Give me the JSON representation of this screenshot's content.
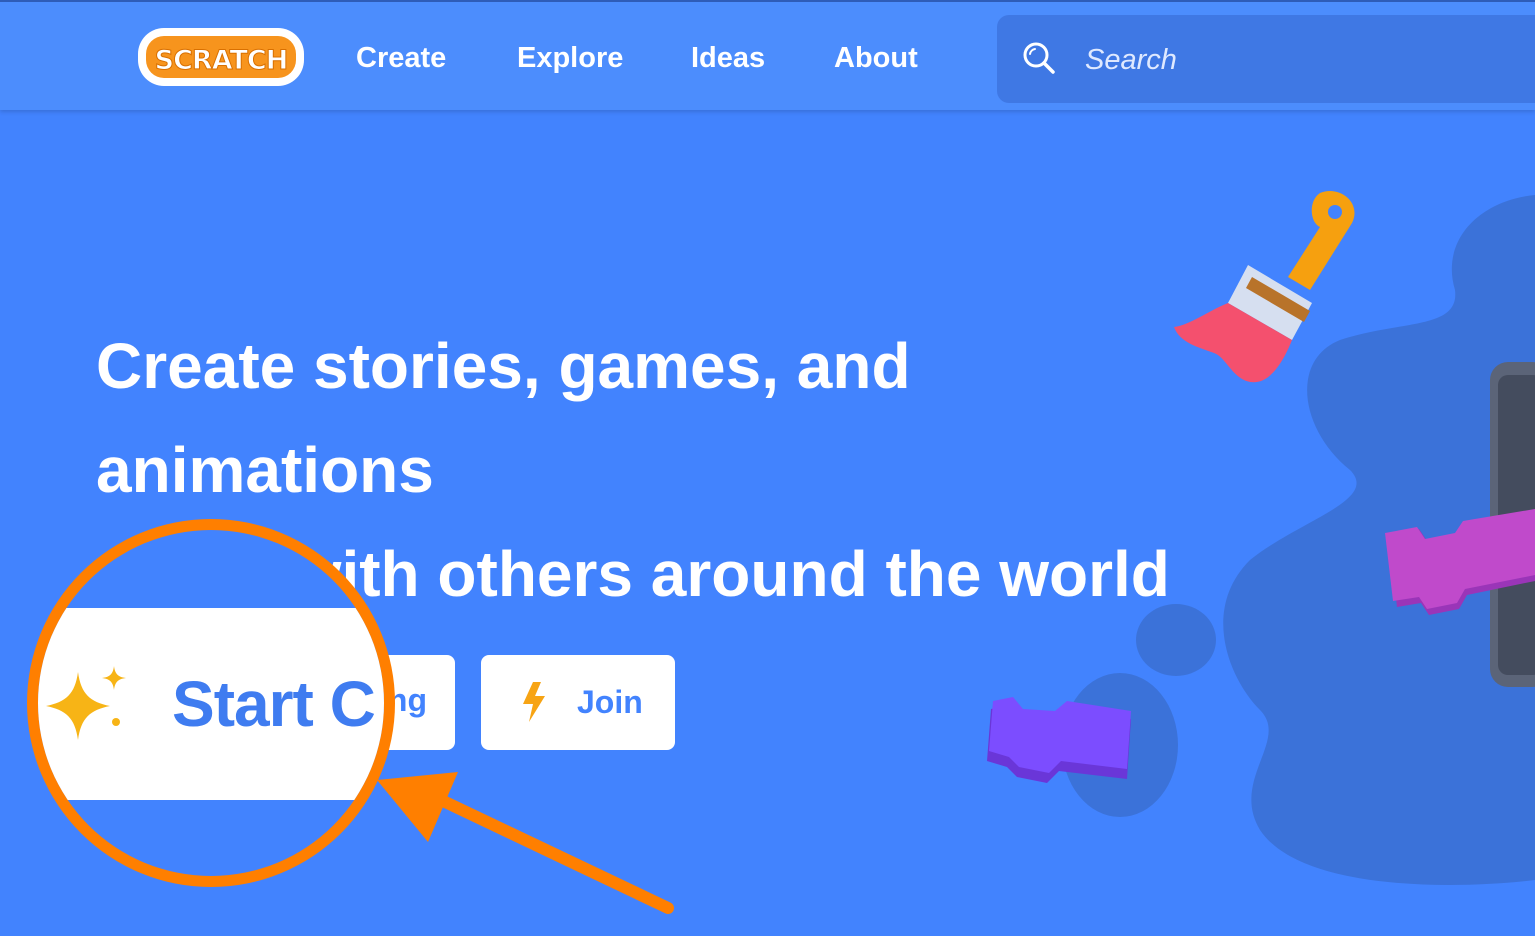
{
  "nav": {
    "logo_text": "SCRATCH",
    "links": [
      "Create",
      "Explore",
      "Ideas",
      "About"
    ],
    "search": {
      "placeholder": "Search",
      "icon": "search-icon"
    }
  },
  "hero": {
    "headline_lines": [
      "Create stories, games, and",
      "animations",
      "Share with others around the world"
    ],
    "buttons": {
      "start": {
        "label": "Start Creating",
        "icon": "sparkle-icon"
      },
      "join": {
        "label": "Join",
        "icon": "bolt-icon"
      }
    },
    "magnifier_label": "Start C"
  },
  "colors": {
    "background": "#4283fe",
    "nav": "#4c8dfd",
    "callout": "#ff7f00",
    "logo_orange": "#f7941d",
    "button_text": "#4283fe"
  }
}
